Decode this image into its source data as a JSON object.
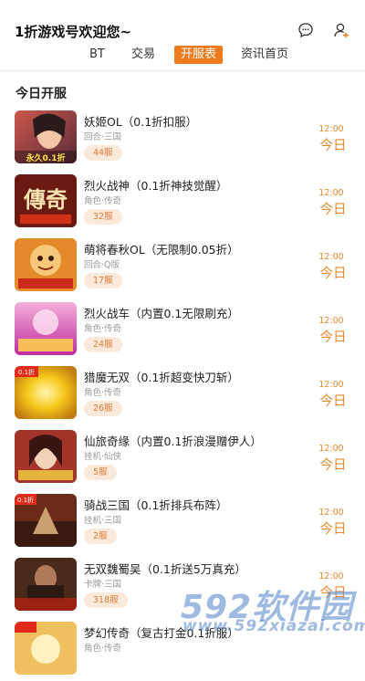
{
  "header": {
    "title": "1折游戏号欢迎您~",
    "icons": [
      "chat-bubble-icon",
      "user-profile-icon"
    ]
  },
  "tabs": [
    {
      "label": "BT",
      "active": false
    },
    {
      "label": "交易",
      "active": false
    },
    {
      "label": "开服表",
      "active": true
    },
    {
      "label": "资讯首页",
      "active": false
    }
  ],
  "section_title": "今日开服",
  "accent_color": "#f07b1f",
  "games": [
    {
      "name": "妖姬OL（0.1折扣服）",
      "tags": "回合·三国",
      "servers": "44服",
      "time": "12:00",
      "day": "今日"
    },
    {
      "name": "烈火战神（0.1折神技觉醒）",
      "tags": "角色·传奇",
      "servers": "32服",
      "time": "12:00",
      "day": "今日"
    },
    {
      "name": "萌将春秋OL（无限制0.05折）",
      "tags": "回合·Q版",
      "servers": "17服",
      "time": "12:00",
      "day": "今日"
    },
    {
      "name": "烈火战车（内置0.1无限刷充）",
      "tags": "角色·传奇",
      "servers": "24服",
      "time": "12:00",
      "day": "今日"
    },
    {
      "name": "猎魔无双（0.1折超变快刀斩）",
      "tags": "角色·传奇",
      "servers": "26服",
      "time": "12:00",
      "day": "今日"
    },
    {
      "name": "仙旅奇缘（内置0.1折浪漫赠伊人）",
      "tags": "挂机·仙侠",
      "servers": "5服",
      "time": "12:00",
      "day": "今日"
    },
    {
      "name": "骑战三国（0.1折排兵布阵）",
      "tags": "挂机·三国",
      "servers": "2服",
      "time": "12:00",
      "day": "今日"
    },
    {
      "name": "无双魏蜀吴（0.1折送5万真充）",
      "tags": "卡牌·三国",
      "servers": "318服",
      "time": "12:00",
      "day": "今日"
    },
    {
      "name": "梦幻传奇（复古打金0.1折服）",
      "tags": "角色·传奇",
      "servers": "",
      "time": "",
      "day": ""
    }
  ],
  "thumb_texts": [
    "永久0.1折",
    "傳奇",
    "",
    "",
    "0.1折",
    "",
    "0.1折",
    "",
    ""
  ],
  "watermark": {
    "big": "592软件园",
    "small": "www.592xiazai.com"
  }
}
